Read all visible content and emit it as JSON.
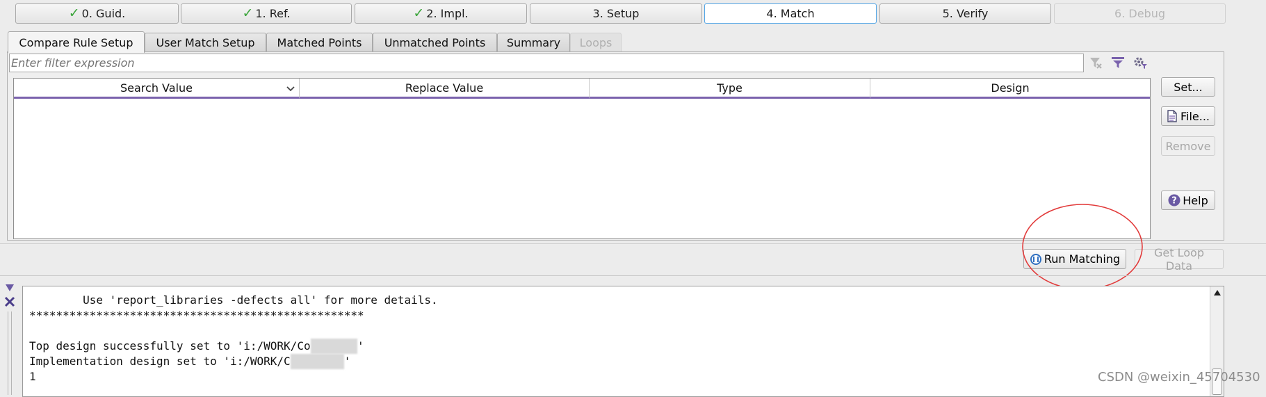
{
  "steps": [
    {
      "label": "0. Guid.",
      "state": "done"
    },
    {
      "label": "1. Ref.",
      "state": "done"
    },
    {
      "label": "2. Impl.",
      "state": "done"
    },
    {
      "label": "3. Setup",
      "state": "normal"
    },
    {
      "label": "4. Match",
      "state": "active"
    },
    {
      "label": "5. Verify",
      "state": "normal"
    },
    {
      "label": "6. Debug",
      "state": "disabled"
    }
  ],
  "tabs": [
    {
      "label": "Compare Rule Setup"
    },
    {
      "label": "User Match Setup"
    },
    {
      "label": "Matched Points"
    },
    {
      "label": "Unmatched Points"
    },
    {
      "label": "Summary"
    },
    {
      "label": "Loops"
    }
  ],
  "filter": {
    "placeholder": "Enter filter expression"
  },
  "table": {
    "columns": [
      "Search Value",
      "Replace Value",
      "Type",
      "Design"
    ],
    "rows": []
  },
  "side_buttons": {
    "set": "Set...",
    "file": "File...",
    "remove": "Remove",
    "help": "Help"
  },
  "actions": {
    "run_matching": "Run Matching",
    "get_loop_data": "Get Loop Data"
  },
  "console": {
    "lines": [
      "        Use 'report_libraries -defects all' for more details.",
      "**************************************************",
      "",
      "Top design successfully set to 'i:/WORK/Co",
      "Implementation design set to 'i:/WORK/C",
      "1"
    ],
    "top_suffix": "'",
    "impl_suffix": "'"
  },
  "watermark": "CSDN @weixin_45704530",
  "colors": {
    "accent": "#55a6e6",
    "check": "#3aa43a",
    "header_underline": "#7a62ad",
    "annotation_circle": "#e23b3b"
  }
}
